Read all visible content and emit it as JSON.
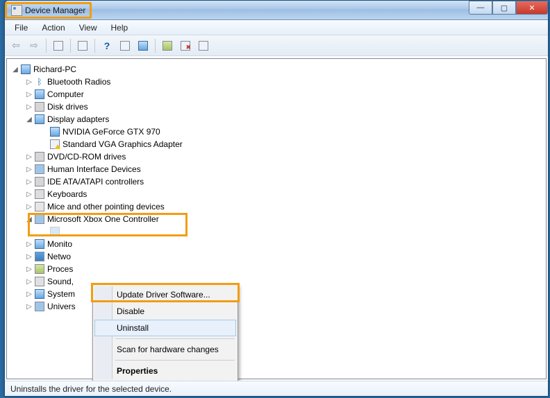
{
  "window": {
    "title": "Device Manager"
  },
  "menu": {
    "file": "File",
    "action": "Action",
    "view": "View",
    "help": "Help"
  },
  "toolbar": {
    "back": "←",
    "forward": "→",
    "show_hidden": "▥",
    "properties": "☐",
    "help": "?",
    "refresh": "⟳",
    "remove": "✖",
    "update": "⚙",
    "uninstall": "✖",
    "scan": "↻"
  },
  "tree": {
    "root": "Richard-PC",
    "items": [
      {
        "label": "Bluetooth Radios",
        "expanded": false
      },
      {
        "label": "Computer",
        "expanded": false
      },
      {
        "label": "Disk drives",
        "expanded": false
      },
      {
        "label": "Display adapters",
        "expanded": true,
        "children": [
          {
            "label": "NVIDIA GeForce GTX 970"
          },
          {
            "label": "Standard VGA Graphics Adapter",
            "warn": true
          }
        ]
      },
      {
        "label": "DVD/CD-ROM drives",
        "expanded": false
      },
      {
        "label": "Human Interface Devices",
        "expanded": false
      },
      {
        "label": "IDE ATA/ATAPI controllers",
        "expanded": false
      },
      {
        "label": "Keyboards",
        "expanded": false
      },
      {
        "label": "Mice and other pointing devices",
        "expanded": false
      },
      {
        "label": "Microsoft Xbox One Controller",
        "expanded": true,
        "highlight": true
      },
      {
        "label": "Monito"
      },
      {
        "label": "Netwo"
      },
      {
        "label": "Proces"
      },
      {
        "label": "Sound,"
      },
      {
        "label": "System"
      },
      {
        "label": "Univers"
      }
    ]
  },
  "context_menu": {
    "update": "Update Driver Software...",
    "disable": "Disable",
    "uninstall": "Uninstall",
    "scan": "Scan for hardware changes",
    "properties": "Properties"
  },
  "statusbar": {
    "text": "Uninstalls the driver for the selected device."
  },
  "highlight_color": "#f39c12"
}
